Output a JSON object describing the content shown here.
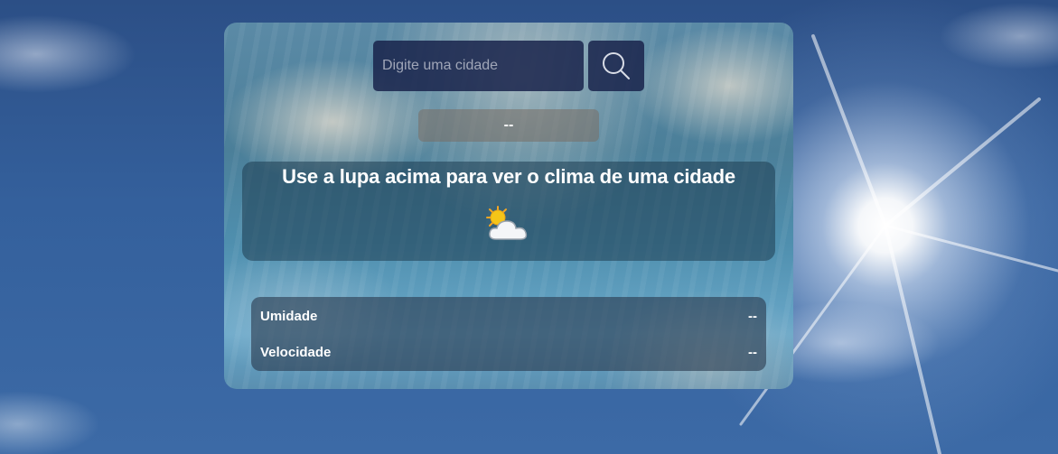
{
  "search": {
    "placeholder": "Digite uma cidade",
    "value": "",
    "button_icon": "search-icon"
  },
  "city": {
    "name": "--"
  },
  "main": {
    "message": "Use a lupa acima para ver o clima de uma cidade",
    "weather_icon": "sun-behind-cloud-icon"
  },
  "details": {
    "humidity_label": "Umidade",
    "humidity_value": "--",
    "speed_label": "Velocidade",
    "speed_value": "--"
  },
  "colors": {
    "input_bg": "#19234b",
    "text": "#ffffff",
    "placeholder": "#a0a6b8",
    "sun": "#f5c518"
  }
}
